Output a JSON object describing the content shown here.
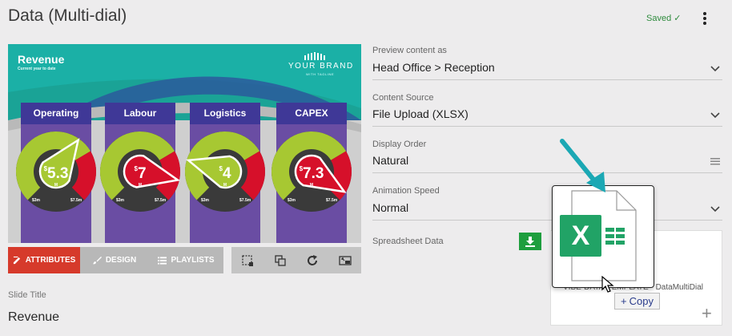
{
  "page": {
    "title": "Data (Multi-dial)",
    "saved": "Saved"
  },
  "preview": {
    "title": "Revenue",
    "subtitle": "Current year to date",
    "brand": "YOUR BRAND",
    "brand_sub": "WITH TAGLINE",
    "dials": [
      {
        "name": "Operating",
        "value": "5.3",
        "unit": "M",
        "currency": "$",
        "min": "$3m",
        "max": "$7.5m",
        "fill": 0.63,
        "color": "#a7c832"
      },
      {
        "name": "Labour",
        "value": "7",
        "unit": "M",
        "currency": "$",
        "min": "$3m",
        "max": "$7.5m",
        "fill": 0.88,
        "color": "#d6102a"
      },
      {
        "name": "Logistics",
        "value": "4",
        "unit": "M",
        "currency": "$",
        "min": "$3m",
        "max": "$7.5m",
        "fill": 0.23,
        "color": "#a7c832"
      },
      {
        "name": "CAPEX",
        "value": "7.3",
        "unit": "M",
        "currency": "$",
        "min": "$3m",
        "max": "$7.5m",
        "fill": 0.95,
        "color": "#d6102a"
      }
    ]
  },
  "tabs": {
    "attributes": "ATTRIBUTES",
    "design": "DESIGN",
    "playlists": "PLAYLISTS"
  },
  "slide": {
    "label": "Slide Title",
    "value": "Revenue"
  },
  "form": {
    "preview_label": "Preview content as",
    "preview_value": "Head Office > Reception",
    "source_label": "Content Source",
    "source_value": "File Upload (XLSX)",
    "order_label": "Display Order",
    "order_value": "Natural",
    "speed_label": "Animation Speed",
    "speed_value": "Normal",
    "sheet_label": "Spreadsheet Data"
  },
  "dropzone": {
    "file_name": "VIBE-DATA-TEMPLATE - DataMultiDial",
    "copy_label": "Copy"
  },
  "colors": {
    "accent": "#d63a2b",
    "teal": "#1bb0a6",
    "purple": "#6a4da3",
    "green": "#1e9e3e",
    "excel": "#21a366"
  }
}
